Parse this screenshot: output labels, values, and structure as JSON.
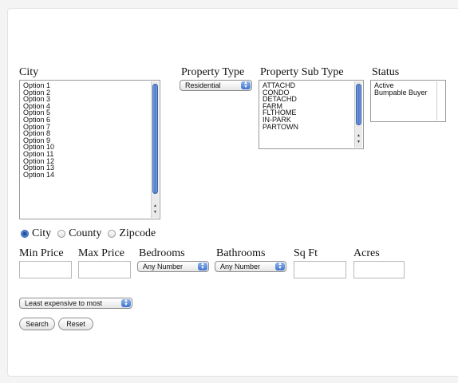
{
  "labels": {
    "city": "City",
    "property_type": "Property Type",
    "property_sub_type": "Property Sub Type",
    "status": "Status",
    "min_price": "Min Price",
    "max_price": "Max Price",
    "bedrooms": "Bedrooms",
    "bathrooms": "Bathrooms",
    "sqft": "Sq Ft",
    "acres": "Acres"
  },
  "city_options": [
    "Option 1",
    "Option 2",
    "Option 3",
    "Option 4",
    "Option 5",
    "Option 6",
    "Option 7",
    "Option 8",
    "Option 9",
    "Option 10",
    "Option 11",
    "Option 12",
    "Option 13",
    "Option 14"
  ],
  "property_type": {
    "selected": "Residential"
  },
  "property_sub_type_options": [
    "ATTACHD",
    "CONDO",
    "DETACHD",
    "FARM",
    "FLTHOME",
    "IN-PARK",
    "PARTOWN"
  ],
  "status_options": [
    "Active",
    "Bumpable Buyer"
  ],
  "location_filter": {
    "options": [
      "City",
      "County",
      "Zipcode"
    ],
    "selected": "City"
  },
  "bedrooms": {
    "selected": "Any Number"
  },
  "bathrooms": {
    "selected": "Any Number"
  },
  "sort": {
    "selected": "Least expensive to most"
  },
  "buttons": {
    "search": "Search",
    "reset": "Reset"
  },
  "icons": {
    "select_arrow": "updown-chevron-icon",
    "radio": "radio-icon"
  }
}
